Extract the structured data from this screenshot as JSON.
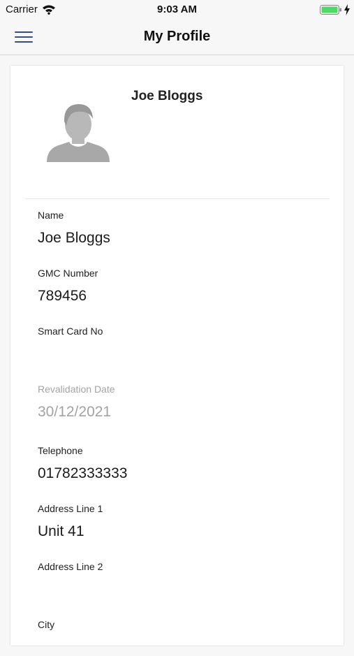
{
  "status_bar": {
    "carrier": "Carrier",
    "time": "9:03 AM",
    "battery_color": "#4cd964"
  },
  "nav": {
    "title": "My Profile",
    "accent_color": "#3b4a8a"
  },
  "profile": {
    "name": "Joe Bloggs"
  },
  "fields": [
    {
      "label": "Name",
      "value": "Joe Bloggs",
      "editable": true
    },
    {
      "label": "GMC Number",
      "value": "789456",
      "editable": true
    },
    {
      "label": "Smart Card No",
      "value": "",
      "editable": true
    },
    {
      "label": "Revalidation Date",
      "value": "30/12/2021",
      "editable": false
    },
    {
      "label": "Telephone",
      "value": "01782333333",
      "editable": true
    },
    {
      "label": "Address Line 1",
      "value": "Unit 41",
      "editable": true
    },
    {
      "label": "Address Line 2",
      "value": "",
      "editable": true
    },
    {
      "label": "City",
      "value": "",
      "editable": true
    }
  ]
}
